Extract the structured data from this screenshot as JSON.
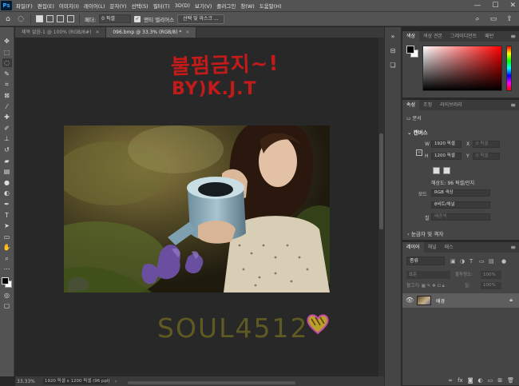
{
  "app_logo": "Ps",
  "menu": [
    "파일(F)",
    "편집(E)",
    "이미지(I)",
    "레이어(L)",
    "문자(Y)",
    "선택(S)",
    "필터(T)",
    "3D(D)",
    "보기(V)",
    "플러그인",
    "창(W)",
    "도움말(H)"
  ],
  "window_controls": {
    "minimize": "—",
    "maximize": "☐",
    "close": "✕"
  },
  "options": {
    "feather_label": "페더:",
    "feather_value": "0 픽셀",
    "antialias_label": "앤티 앨리어스",
    "antialias_checked": true,
    "select_mask_button": "선택 및 마스크 ..."
  },
  "tabs": [
    {
      "label": "제목 없음-1 @ 100% (RGB/8#)",
      "active": false
    },
    {
      "label": "096.bmp @ 33.3% (RGB/8) *",
      "active": true
    }
  ],
  "canvas": {
    "text_line1": "불펌금지~!",
    "text_line2": "BY)K.J.T",
    "signature": "SOUL4512",
    "text_color": "#c31a1a",
    "signature_color": "#5e5a22"
  },
  "status": {
    "zoom": "33.33%",
    "doc_info": "1920 픽셀 x 1200 픽셀 (96 ppi)"
  },
  "color_panel": {
    "tabs": [
      "색상",
      "색상 견본",
      "그레이디언트",
      "패턴"
    ],
    "foreground": "#000000",
    "background": "#ffffff"
  },
  "properties_panel": {
    "tabs": [
      "속성",
      "조정",
      "라이브러리"
    ],
    "doc_label": "문서",
    "canvas_label": "캔버스",
    "w_label": "W",
    "w_value": "1920 픽셀",
    "h_label": "H",
    "h_value": "1200 픽셀",
    "x_label": "X",
    "x_value": "0 픽셀",
    "y_label": "Y",
    "y_value": "0 픽셀",
    "resolution": "해상도: 96 픽셀/인치",
    "mode_label": "모드",
    "mode_value": "RGB 색상",
    "depth_value": "8비트/채널",
    "fill_label": "칠",
    "fill_value": "배경색",
    "rulers_section": "눈금자 및 격자"
  },
  "layers_panel": {
    "tabs": [
      "레이어",
      "채널",
      "패스"
    ],
    "search_placeholder": "종류",
    "blend_mode": "표준",
    "opacity_label": "불투명도:",
    "opacity_value": "100%",
    "lock_label": "잠그기:",
    "fill_label": "칠:",
    "fill_value": "100%",
    "layer_name": "배경"
  }
}
